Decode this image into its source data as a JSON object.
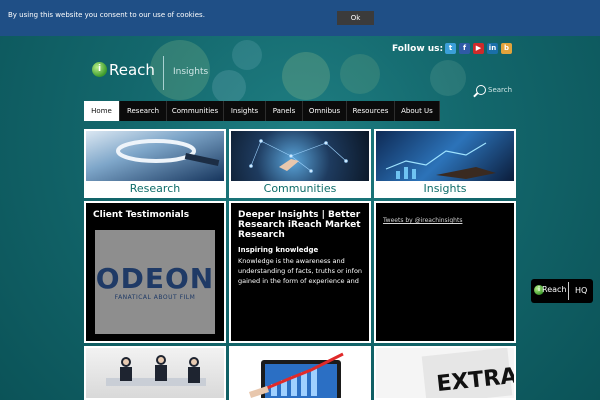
{
  "cookie_bar": {
    "message": "By using this website you consent to our use of cookies.",
    "ok_label": "Ok"
  },
  "header": {
    "logo_initial": "i",
    "logo_text": "Reach",
    "logo_subtitle": "Insights",
    "follow_label": "Follow us:",
    "social_icons": [
      "twitter-icon",
      "facebook-icon",
      "youtube-icon",
      "linkedin-icon",
      "blog-icon"
    ],
    "search_placeholder": "Search"
  },
  "nav": {
    "items": [
      "Home",
      "Research",
      "Communities",
      "Insights",
      "Panels",
      "Omnibus",
      "Resources",
      "About Us"
    ],
    "active": "Home"
  },
  "cards": [
    {
      "label": "Research"
    },
    {
      "label": "Communities"
    },
    {
      "label": "Insights"
    }
  ],
  "panels": {
    "testimonials": {
      "title": "Client Testimonials",
      "logo_name": "ODEON",
      "logo_tagline": "FANATICAL ABOUT FILM"
    },
    "deeper": {
      "title": "Deeper Insights | Better Research iReach Market Research",
      "subtitle": "Inspiring knowledge",
      "body": "Knowledge is the awareness and understanding of facts, truths or infon gained in the form of experience and"
    },
    "tweets": {
      "link": "Tweets by @ireachinsights"
    }
  },
  "hq_badge": {
    "logo_initial": "i",
    "logo_text": "Reach",
    "label": "HQ"
  },
  "colors": {
    "background": "#13676c",
    "cookie_bar": "#1f4f86",
    "nav": "#0b0b0b",
    "card_label": "#0f6d6a"
  }
}
